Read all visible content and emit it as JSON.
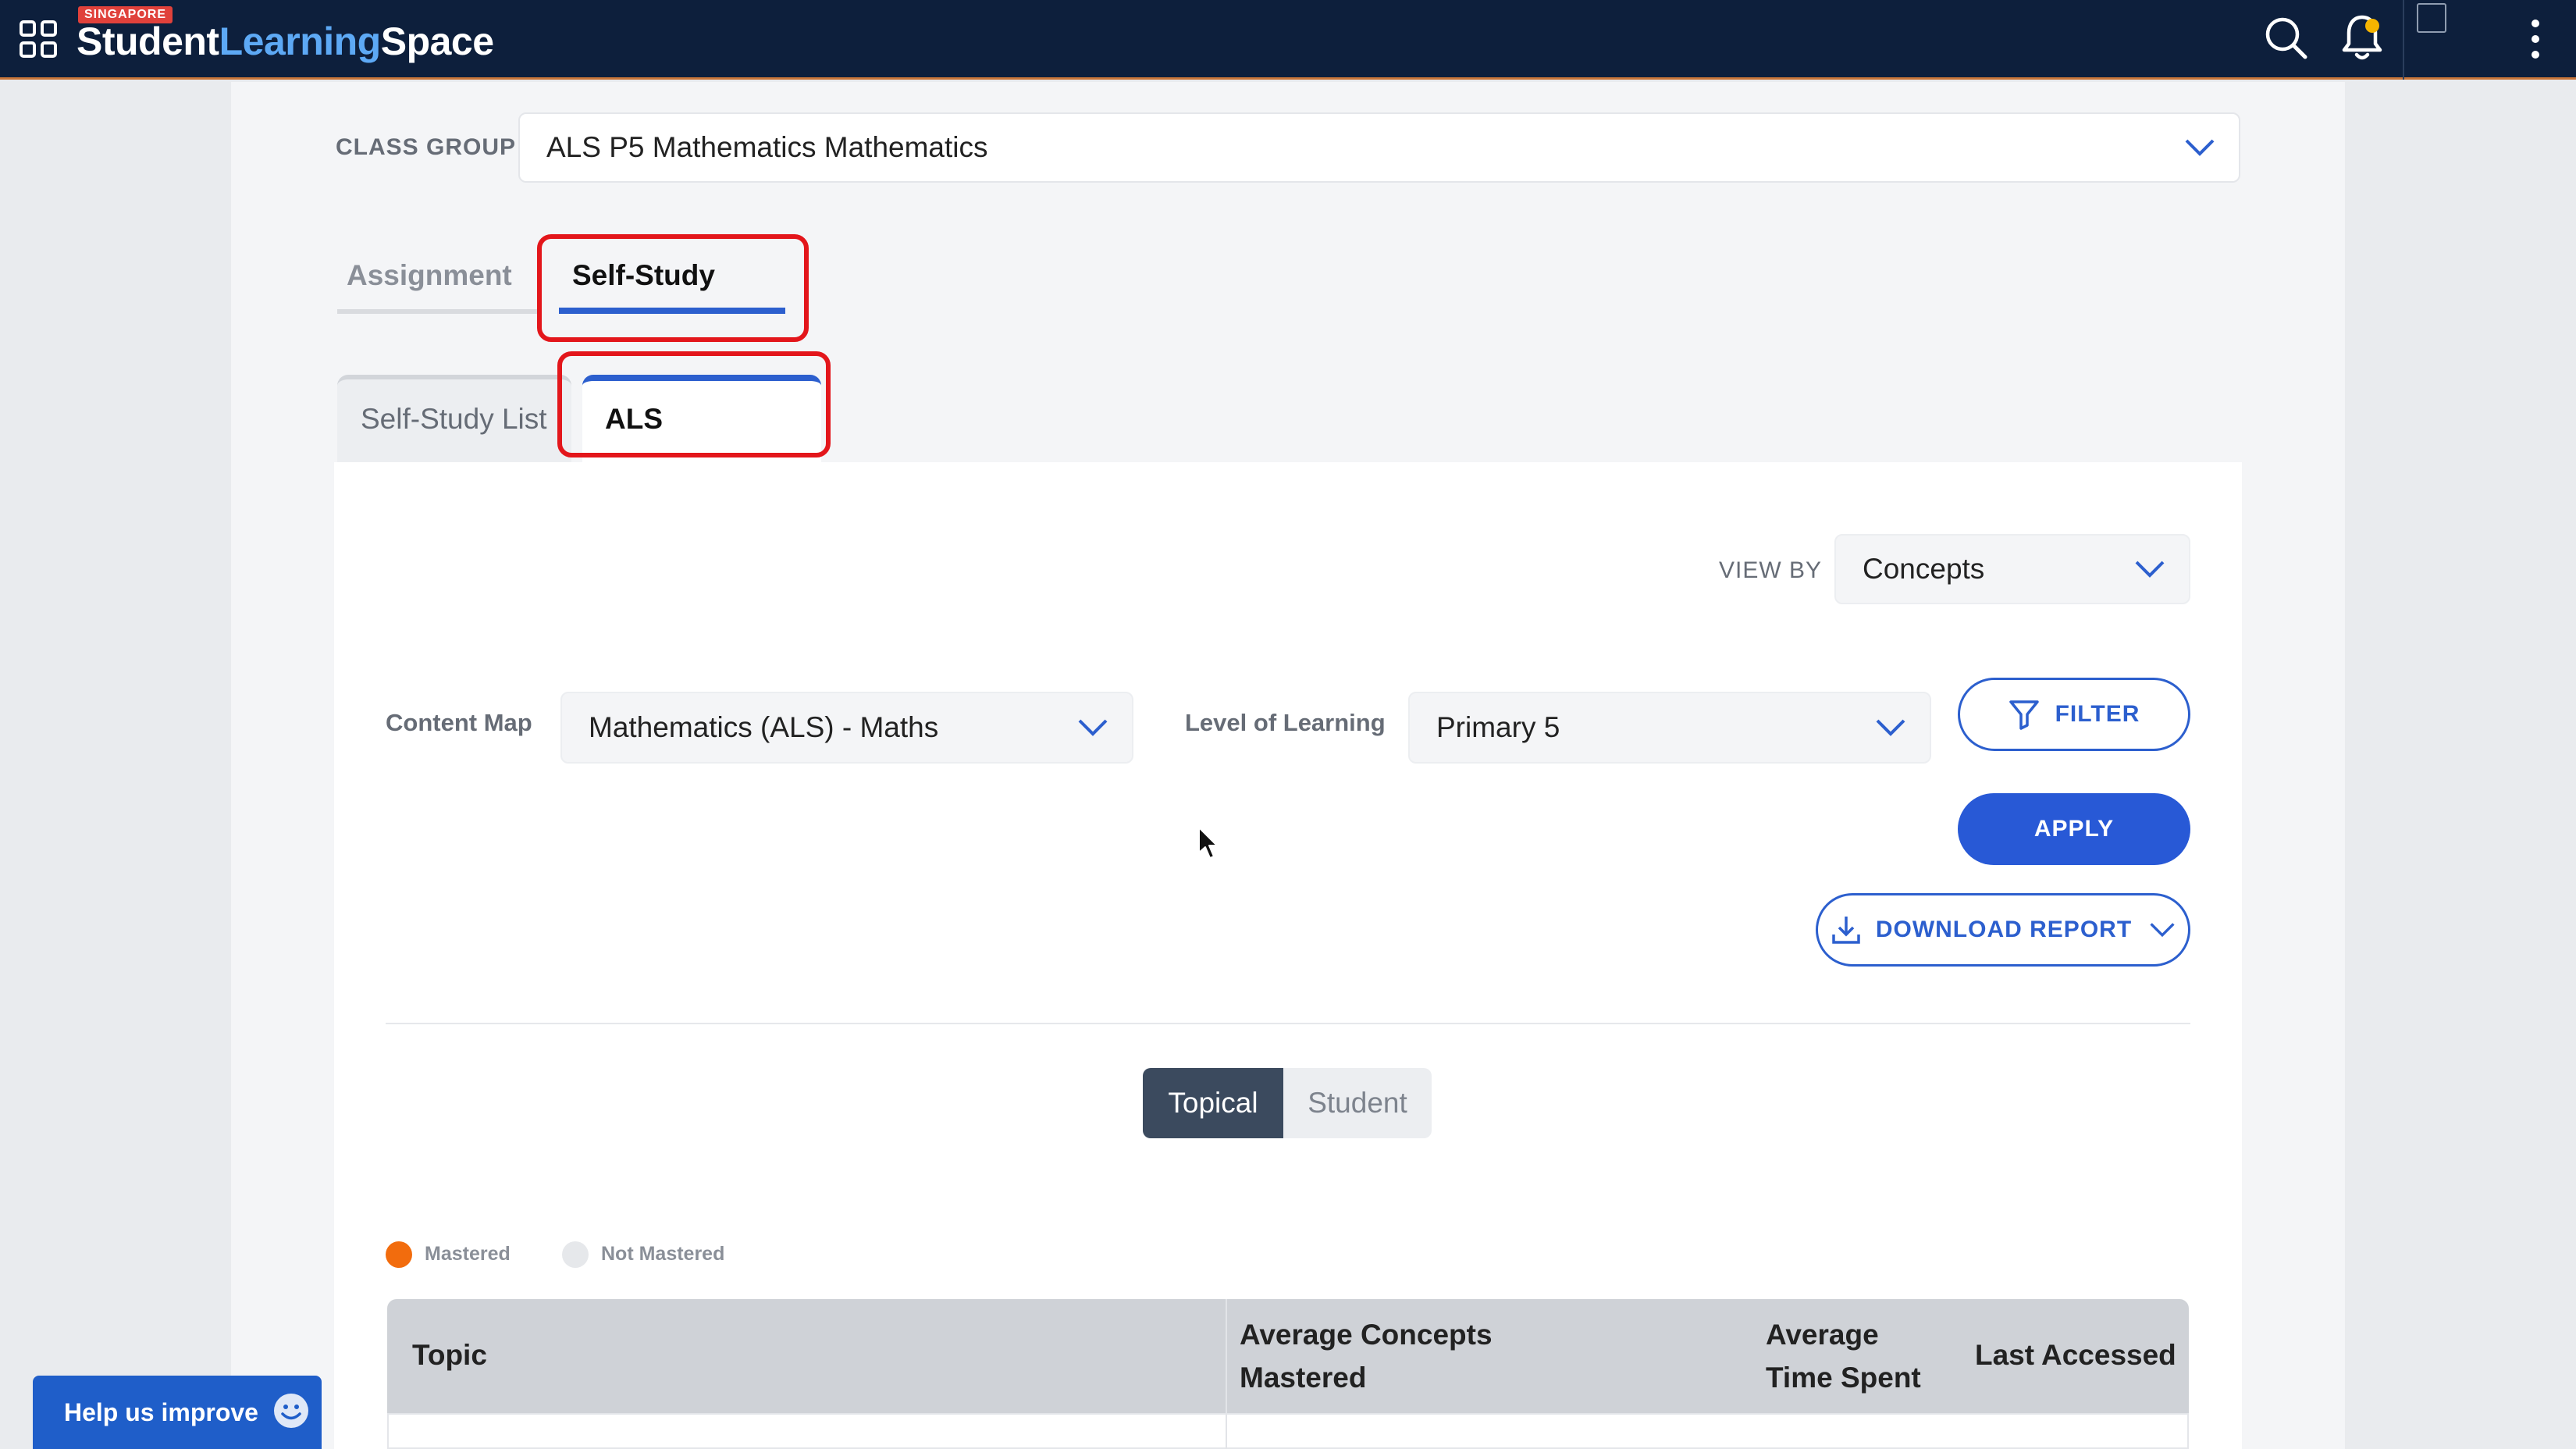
{
  "topbar": {
    "brand_tag": "SINGAPORE",
    "brand_part1": "Student",
    "brand_part2": "Learning",
    "brand_part3": "Space",
    "colors": {
      "bg": "#0d1f3c",
      "accent": "#5da9f5"
    },
    "icons": [
      "apps-grid-icon",
      "search-icon",
      "bell-icon",
      "avatar",
      "more-vertical-icon"
    ]
  },
  "class_group": {
    "label": "CLASS GROUP",
    "value": "ALS P5 Mathematics Mathematics"
  },
  "main_tabs": [
    {
      "label": "Assignment",
      "active": false
    },
    {
      "label": "Self-Study",
      "active": true
    }
  ],
  "sub_tabs": [
    {
      "label": "Self-Study List",
      "active": false
    },
    {
      "label": "ALS",
      "active": true
    }
  ],
  "view_by": {
    "label": "VIEW BY",
    "value": "Concepts"
  },
  "content_map": {
    "label": "Content Map",
    "value": "Mathematics (ALS) - Maths"
  },
  "level_of_learning": {
    "label": "Level of Learning",
    "value": "Primary 5"
  },
  "buttons": {
    "filter": "FILTER",
    "apply": "APPLY",
    "download_report": "DOWNLOAD REPORT"
  },
  "segment": {
    "options": [
      "Topical",
      "Student"
    ],
    "selected": "Topical"
  },
  "legend": [
    {
      "label": "Mastered",
      "color": "#f26c0d"
    },
    {
      "label": "Not Mastered",
      "color": "#e6e8eb"
    }
  ],
  "table": {
    "columns": [
      "Topic",
      "Average Concepts Mastered",
      "Average Time Spent",
      "Last Accessed"
    ]
  },
  "help": {
    "label": "Help us improve"
  }
}
